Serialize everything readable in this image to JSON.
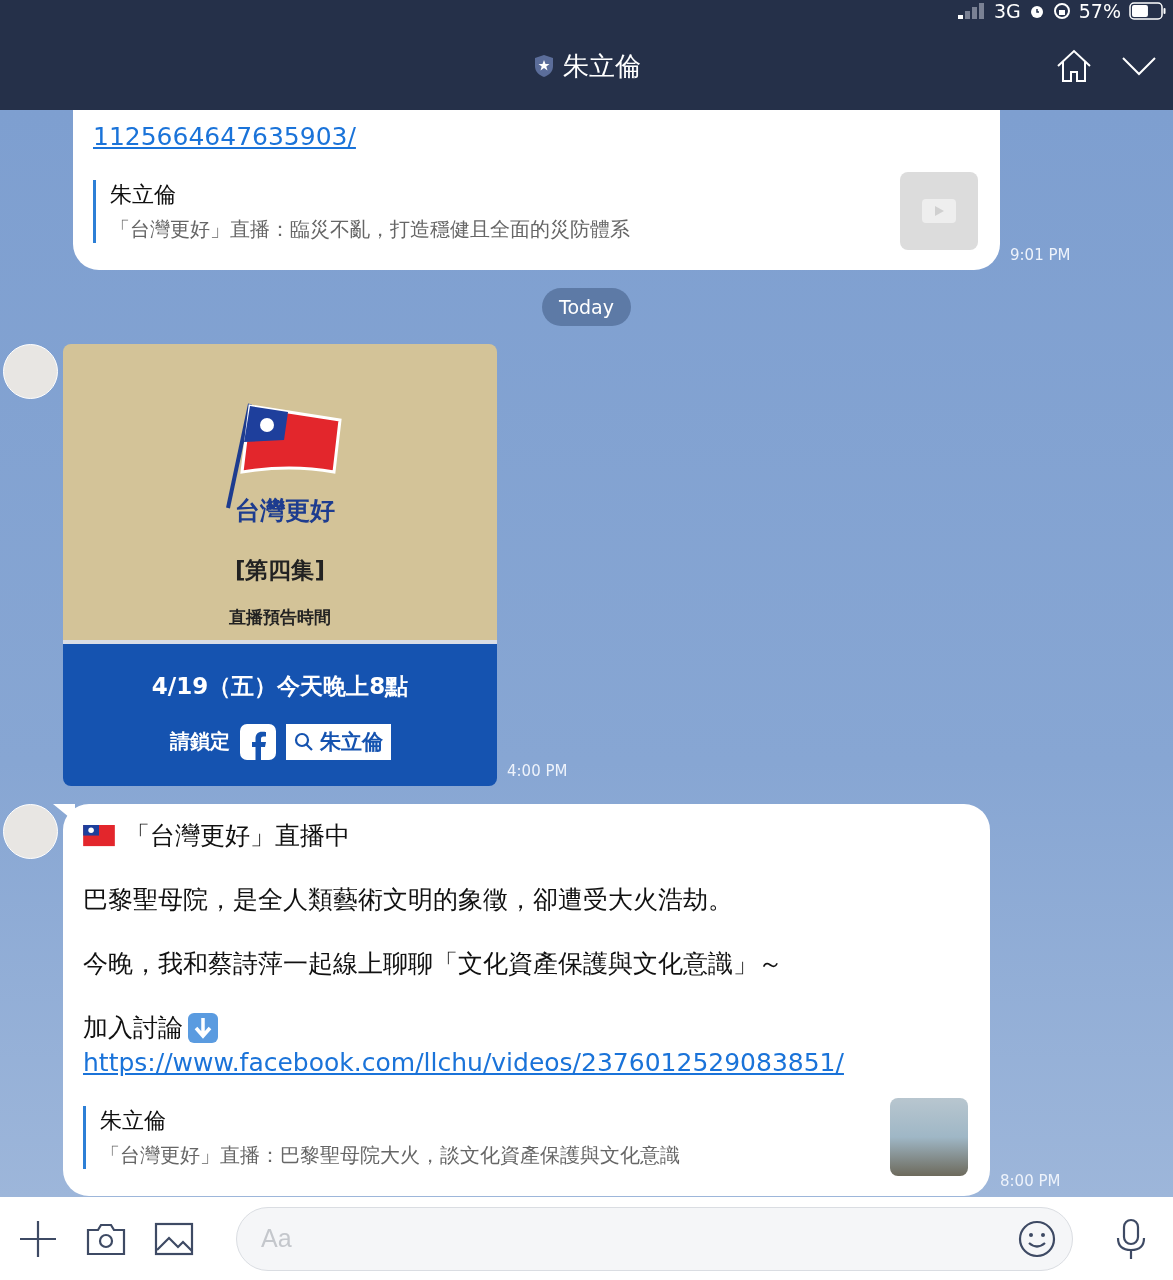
{
  "status_bar": {
    "network": "3G",
    "battery": "57%"
  },
  "header": {
    "title": "朱立倫"
  },
  "messages": [
    {
      "kind": "post",
      "avatar": false,
      "tail": false,
      "link": "1125664647635903/",
      "preview": {
        "kind": "video",
        "title": "朱立倫",
        "description": "「台灣更好」直播：臨災不亂，打造穩健且全面的災防體系"
      },
      "time": "9:01 PM"
    },
    {
      "kind": "separator",
      "label": "Today"
    },
    {
      "kind": "poster",
      "avatar": true,
      "poster": {
        "brand": "台灣更好",
        "episode": "[第四集]",
        "caption": "直播預告時間",
        "date": "4/19（五）今天晚上8點",
        "tune_in": "請鎖定",
        "search": "朱立倫"
      },
      "time": "4:00 PM"
    },
    {
      "kind": "post",
      "avatar": true,
      "tail": true,
      "flag_line": "「台灣更好」直播中",
      "paragraphs": [
        "巴黎聖母院，是全人類藝術文明的象徵，卻遭受大火浩劫。",
        "今晚，我和蔡詩萍一起線上聊聊「文化資產保護與文化意識」～"
      ],
      "discuss": "加入討論",
      "link": "https://www.facebook.com/llchu/videos/2376012529083851/",
      "preview": {
        "kind": "photo",
        "title": "朱立倫",
        "description": "「台灣更好」直播：巴黎聖母院大火，談文化資產保護與文化意識"
      },
      "time": "8:00 PM"
    }
  ],
  "composer": {
    "placeholder": "Aa"
  }
}
